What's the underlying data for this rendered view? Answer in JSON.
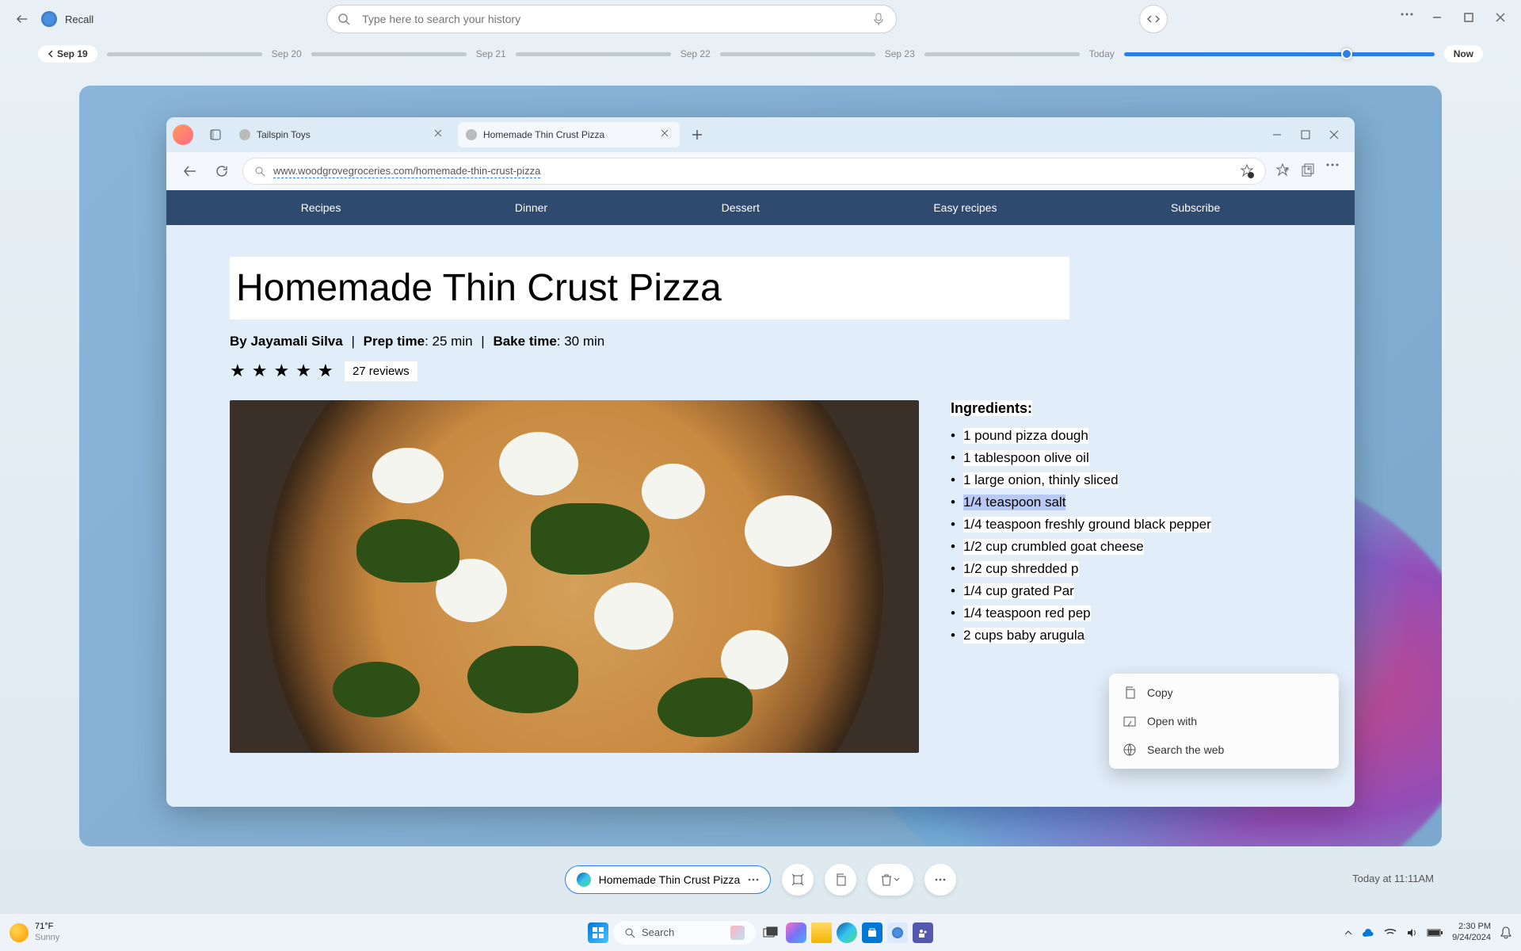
{
  "app": {
    "name": "Recall"
  },
  "search": {
    "placeholder": "Type here to search your history"
  },
  "timeline": {
    "dates": [
      "Sep 19",
      "Sep 20",
      "Sep 21",
      "Sep 22",
      "Sep 23"
    ],
    "today": "Today",
    "now": "Now"
  },
  "browser": {
    "tabs": [
      {
        "title": "Tailspin Toys"
      },
      {
        "title": "Homemade Thin Crust Pizza"
      }
    ],
    "url": "www.woodgrovegroceries.com/homemade-thin-crust-pizza",
    "nav": [
      "Recipes",
      "Dinner",
      "Dessert",
      "Easy recipes",
      "Subscribe"
    ]
  },
  "article": {
    "title": "Homemade Thin Crust Pizza",
    "byline_prefix": "By ",
    "author": "Jayamali Silva",
    "prep_label": "Prep time",
    "prep_value": ": 25 min",
    "bake_label": "Bake time",
    "bake_value": ": 30 min",
    "reviews": "27 reviews",
    "ingredients_label": "Ingredients:",
    "ingredients": [
      "1 pound pizza dough",
      "1 tablespoon olive oil",
      "1 large onion, thinly sliced",
      "1/4 teaspoon salt",
      "1/4 teaspoon freshly ground black pepper",
      "1/2 cup crumbled goat cheese",
      "1/2 cup shredded p",
      "1/4 cup grated Par",
      "1/4 teaspoon red pep",
      "2 cups baby arugula"
    ],
    "selected_index": 3
  },
  "context_menu": {
    "items": [
      "Copy",
      "Open with",
      "Search the web"
    ]
  },
  "bottom": {
    "source": "Homemade Thin Crust Pizza",
    "timestamp": "Today at 11:11AM"
  },
  "taskbar": {
    "temp": "71°F",
    "condition": "Sunny",
    "search": "Search",
    "time": "2:30 PM",
    "date": "9/24/2024"
  }
}
